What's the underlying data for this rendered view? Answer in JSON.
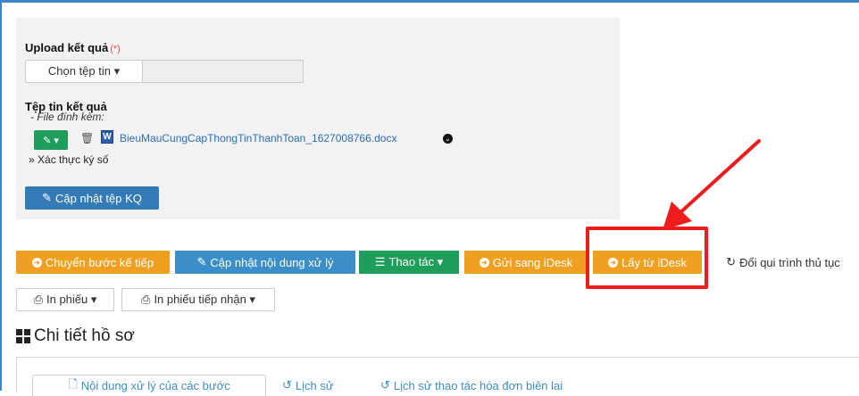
{
  "upload": {
    "label": "Upload kết quả",
    "required_mark": "(*)",
    "choose_file": "Chọn tệp tin ▾",
    "file_value": ""
  },
  "result_files": {
    "label": "Tệp tin kết quả",
    "attach_label": "- File đính kèm:",
    "file_name": "BieuMauCungCapThongTinThanhToan_1627008766.docx",
    "verify": "Xác thực ký số",
    "update_button": "Cập nhật tệp KQ"
  },
  "actions": [
    {
      "label": "Chuyển bước kế tiếp",
      "color": "#f0a020",
      "icon": "circle-arrow-right-icon"
    },
    {
      "label": "Cập nhật nội dung xử lý",
      "color": "#3b8ec8",
      "icon": "edit-icon"
    },
    {
      "label": "Thao tác ▾",
      "color": "#1e9e5a",
      "icon": "list-icon"
    },
    {
      "label": "Gửi sang iDesk",
      "color": "#f0a020",
      "icon": "circle-arrow-right-icon"
    },
    {
      "label": "Lấy từ iDesk",
      "color": "#f0a020",
      "icon": "circle-arrow-right-icon"
    },
    {
      "label": "Đổi qui trình thủ tục",
      "color": "#ffffff",
      "icon": "refresh-icon"
    }
  ],
  "print": {
    "print_form": "In phiếu ▾",
    "print_receipt": "In phiếu tiếp nhận ▾"
  },
  "detail": {
    "title": "Chi tiết hồ sơ",
    "tabs": [
      "Nội dung xử lý của các bước",
      "Lịch sử",
      "Lịch sử thao tác hóa đơn biên lai"
    ]
  }
}
